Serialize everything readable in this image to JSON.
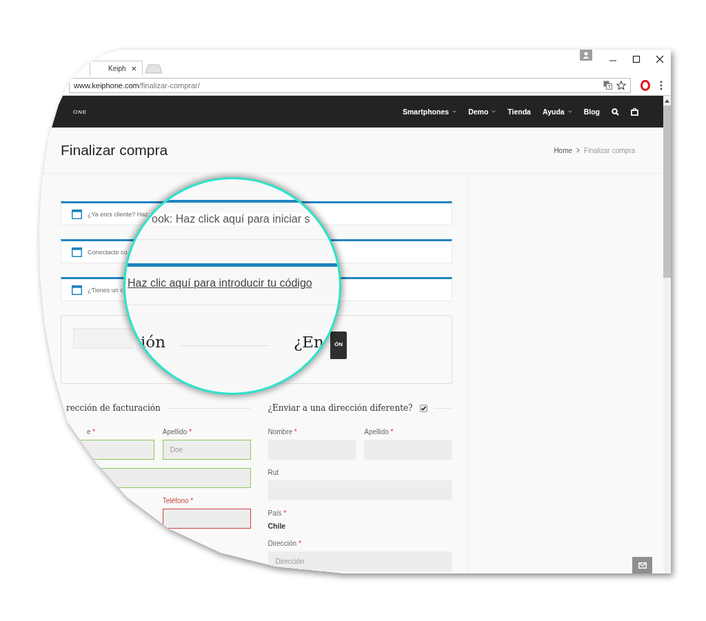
{
  "browser": {
    "tabs": [
      {
        "title": "Keiph",
        "close": "×",
        "selected": true
      }
    ],
    "url_host": "www.keiphone.com",
    "url_path": "/finalizar-comprar/"
  },
  "nav": {
    "logo": "ONE",
    "items": [
      {
        "label": "Smartphones",
        "dropdown": true
      },
      {
        "label": "Demo",
        "dropdown": true
      },
      {
        "label": "Tienda",
        "dropdown": false
      },
      {
        "label": "Ayuda",
        "dropdown": true
      },
      {
        "label": "Blog",
        "dropdown": false
      }
    ]
  },
  "page": {
    "title": "Finalizar compra",
    "breadcrumb": [
      {
        "label": "Home",
        "current": false
      },
      {
        "label": "Finalizar compra",
        "current": true
      }
    ]
  },
  "notices": [
    {
      "text": "¿Ya eres cliente? Haz"
    },
    {
      "text": "Conectacte co"
    },
    {
      "text": "¿Tienes un c"
    }
  ],
  "coupon": {
    "button": "ÓN"
  },
  "magnifier": {
    "notice_text": "ook: Haz click aquí para iniciar s",
    "link_text": "Haz clic aquí para introducir tu código",
    "heading_left": "ión",
    "heading_right": "¿En"
  },
  "billing": {
    "heading": "rección de facturación",
    "fields": [
      {
        "kind": "half",
        "label": "e",
        "req": "*",
        "valid": true,
        "error": false
      },
      {
        "kind": "half",
        "label": "Apellido",
        "req": "*",
        "placeholder": "Doe",
        "valid": true,
        "error": false
      },
      {
        "kind": "full",
        "valid": true,
        "error": false
      },
      {
        "kind": "half",
        "label": "Teléfono",
        "req": "*",
        "valid": false,
        "error": true
      }
    ]
  },
  "shipping": {
    "heading": "¿Enviar a una dirección diferente?",
    "checked": true,
    "fields": [
      {
        "kind": "half",
        "label": "Nombre",
        "req": "*",
        "valid": false,
        "error": false
      },
      {
        "kind": "half",
        "label": "Apellido",
        "req": "*",
        "valid": false,
        "error": false
      },
      {
        "kind": "full",
        "label": "Rut",
        "valid": false,
        "error": false
      },
      {
        "kind": "text",
        "label": "País",
        "req": "*",
        "value": "Chile"
      },
      {
        "kind": "full",
        "label": "Dirección",
        "req": "*",
        "placeholder": "Dirección",
        "valid": false,
        "error": false
      }
    ]
  }
}
